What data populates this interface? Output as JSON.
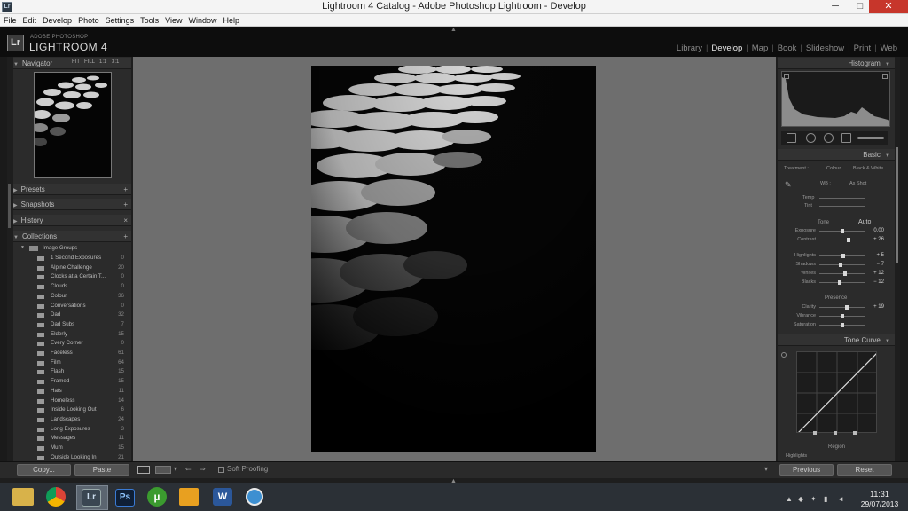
{
  "window": {
    "title": "Lightroom 4 Catalog - Adobe Photoshop Lightroom - Develop",
    "min_glyph": "─",
    "max_glyph": "□",
    "close_glyph": "✕",
    "app_icon": "Lr"
  },
  "menubar": {
    "items": [
      "File",
      "Edit",
      "Develop",
      "Photo",
      "Settings",
      "Tools",
      "View",
      "Window",
      "Help"
    ]
  },
  "identity": {
    "logo": "Lr",
    "brand_small": "ADOBE PHOTOSHOP",
    "brand_big": "LIGHTROOM 4"
  },
  "modules": {
    "items": [
      "Library",
      "Develop",
      "Map",
      "Book",
      "Slideshow",
      "Print",
      "Web"
    ],
    "active": "Develop",
    "separator": "|"
  },
  "left_panel": {
    "navigator": {
      "title": "Navigator",
      "zoom_options": [
        "FIT",
        "FILL",
        "1:1",
        "3:1"
      ]
    },
    "presets": {
      "title": "Presets",
      "action": "+"
    },
    "snapshots": {
      "title": "Snapshots",
      "action": "+"
    },
    "history": {
      "title": "History",
      "action": "×"
    },
    "collections": {
      "title": "Collections",
      "action": "+",
      "group": "Image Groups",
      "items": [
        {
          "name": "1 Second Exposures",
          "count": "0"
        },
        {
          "name": "Alpine Challenge",
          "count": "20"
        },
        {
          "name": "Clocks at a Certain T...",
          "count": "0"
        },
        {
          "name": "Clouds",
          "count": "0"
        },
        {
          "name": "Colour",
          "count": "36"
        },
        {
          "name": "Conversations",
          "count": "0"
        },
        {
          "name": "Dad",
          "count": "32"
        },
        {
          "name": "Dad Subs",
          "count": "7"
        },
        {
          "name": "Elderly",
          "count": "15"
        },
        {
          "name": "Every Corner",
          "count": "0"
        },
        {
          "name": "Faceless",
          "count": "61"
        },
        {
          "name": "Film",
          "count": "64"
        },
        {
          "name": "Flash",
          "count": "15"
        },
        {
          "name": "Framed",
          "count": "15"
        },
        {
          "name": "Hats",
          "count": "11"
        },
        {
          "name": "Homeless",
          "count": "14"
        },
        {
          "name": "Inside Looking Out",
          "count": "6"
        },
        {
          "name": "Landscapes",
          "count": "24"
        },
        {
          "name": "Long Exposures",
          "count": "3"
        },
        {
          "name": "Messages",
          "count": "11"
        },
        {
          "name": "Mum",
          "count": "15"
        },
        {
          "name": "Outside Looking In",
          "count": "21"
        }
      ]
    }
  },
  "right_panel": {
    "histogram": {
      "title": "Histogram"
    },
    "basic": {
      "title": "Basic",
      "treatment_label": "Treatment :",
      "treatment_options": [
        "Colour",
        "Black & White"
      ],
      "wb_label": "WB :",
      "wb_value": "As Shot",
      "temp_label": "Temp",
      "tint_label": "Tint",
      "tone_label": "Tone",
      "auto_label": "Auto",
      "presence_label": "Presence",
      "sliders": [
        {
          "label": "Exposure",
          "value": "0.00",
          "level": 0.5
        },
        {
          "label": "Contrast",
          "value": "+ 26",
          "level": 0.63
        },
        {
          "label": "Highlights",
          "value": "+ 5",
          "level": 0.52
        },
        {
          "label": "Shadows",
          "value": "− 7",
          "level": 0.46
        },
        {
          "label": "Whites",
          "value": "+ 12",
          "level": 0.56
        },
        {
          "label": "Blacks",
          "value": "− 12",
          "level": 0.44
        },
        {
          "label": "Clarity",
          "value": "+ 19",
          "level": 0.6
        },
        {
          "label": "Vibrance",
          "value": "",
          "level": 0.5
        },
        {
          "label": "Saturation",
          "value": "",
          "level": 0.5
        }
      ]
    },
    "tone_curve": {
      "title": "Tone Curve",
      "region_label": "Region",
      "highlights_label": "Highlights"
    }
  },
  "toolbar": {
    "copy_label": "Copy...",
    "paste_label": "Paste",
    "soft_proofing": "Soft Proofing",
    "previous_label": "Previous",
    "reset_label": "Reset"
  },
  "taskbar": {
    "time": "11:31",
    "date": "29/07/2013"
  },
  "colors": {
    "close_red": "#c7362b",
    "panel_bg": "#2b2b2b",
    "center_bg": "#6e6e6e",
    "taskbar_bg": "#2b3036"
  }
}
